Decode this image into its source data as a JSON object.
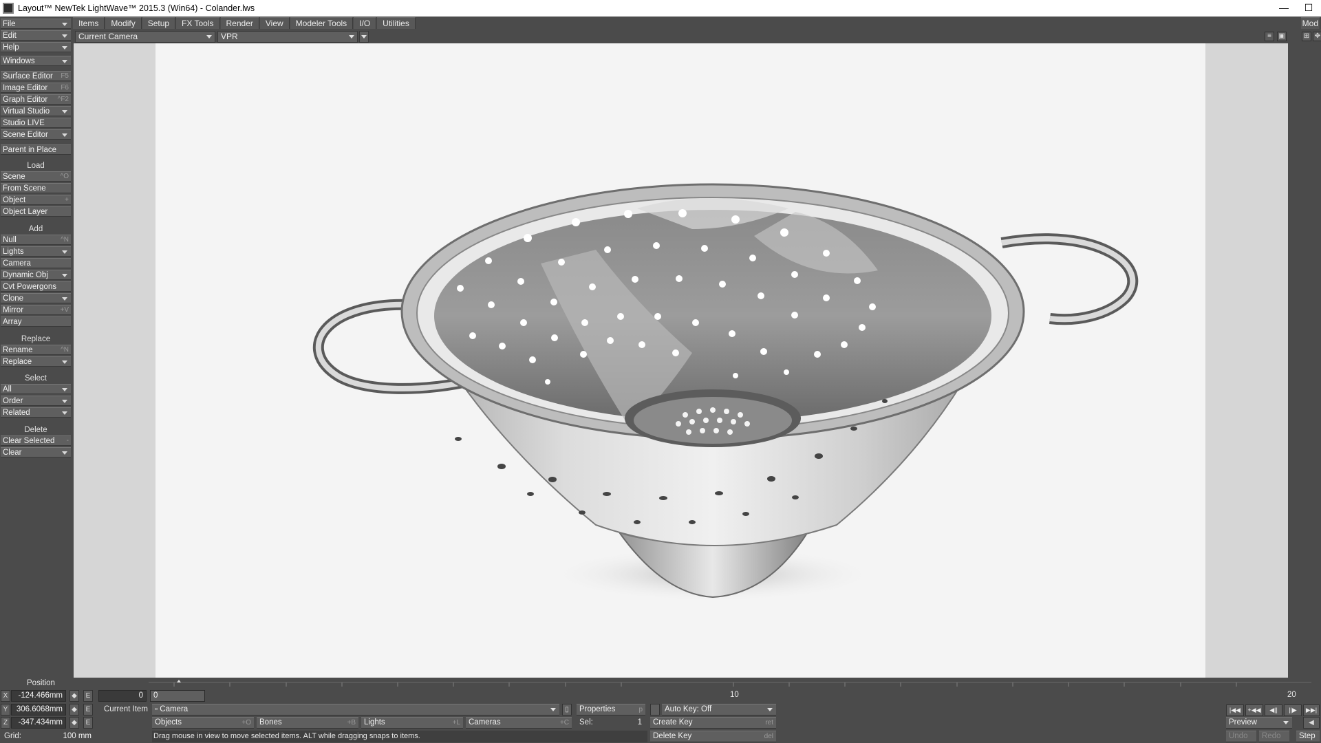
{
  "window": {
    "title": "Layout™ NewTek LightWave™ 2015.3 (Win64) - Colander.lws",
    "minimize": "—",
    "maximize": "☐"
  },
  "menu": {
    "file": "File",
    "edit": "Edit",
    "help": "Help",
    "windows": "Windows",
    "editors": [
      {
        "label": "Surface Editor",
        "shortcut": "F5"
      },
      {
        "label": "Image Editor",
        "shortcut": "F6"
      },
      {
        "label": "Graph Editor",
        "shortcut": "^F2"
      },
      {
        "label": "Virtual Studio",
        "shortcut": ""
      },
      {
        "label": "Studio LIVE",
        "shortcut": ""
      },
      {
        "label": "Scene Editor",
        "shortcut": ""
      }
    ],
    "parent_in_place": "Parent in Place",
    "load_header": "Load",
    "load": [
      {
        "label": "Scene",
        "shortcut": "^O"
      },
      {
        "label": "From Scene",
        "shortcut": ""
      },
      {
        "label": "Object",
        "shortcut": "+"
      },
      {
        "label": "Object Layer",
        "shortcut": ""
      }
    ],
    "add_header": "Add",
    "add": [
      {
        "label": "Null",
        "shortcut": "^N"
      },
      {
        "label": "Lights",
        "shortcut": ""
      },
      {
        "label": "Camera",
        "shortcut": ""
      },
      {
        "label": "Dynamic Obj",
        "shortcut": ""
      },
      {
        "label": "Cvt Powergons",
        "shortcut": ""
      },
      {
        "label": "Clone",
        "shortcut": ""
      },
      {
        "label": "Mirror",
        "shortcut": "+V"
      },
      {
        "label": "Array",
        "shortcut": ""
      }
    ],
    "replace_header": "Replace",
    "replace": [
      {
        "label": "Rename",
        "shortcut": "^N"
      },
      {
        "label": "Replace",
        "shortcut": ""
      }
    ],
    "select_header": "Select",
    "select": [
      {
        "label": "All",
        "shortcut": ""
      },
      {
        "label": "Order",
        "shortcut": ""
      },
      {
        "label": "Related",
        "shortcut": ""
      }
    ],
    "delete_header": "Delete",
    "delete": [
      {
        "label": "Clear Selected",
        "shortcut": "-"
      },
      {
        "label": "Clear",
        "shortcut": ""
      }
    ]
  },
  "tabs": [
    "Items",
    "Modify",
    "Setup",
    "FX Tools",
    "Render",
    "View",
    "Modeler Tools",
    "I/O",
    "Utilities"
  ],
  "modeler_button": "Mod",
  "viewport": {
    "view_type": "Current Camera",
    "render_mode": "VPR"
  },
  "position": {
    "header": "Position",
    "x": {
      "axis": "X",
      "value": "-124.466mm"
    },
    "y": {
      "axis": "Y",
      "value": "306.6068mm"
    },
    "z": {
      "axis": "Z",
      "value": "-347.434mm"
    },
    "env_label": "E",
    "grid_label": "Grid:",
    "grid_value": "100 mm"
  },
  "timeline": {
    "start_frame": "0",
    "current_frame": "0",
    "ticks": [
      "0",
      "10",
      "20"
    ]
  },
  "current_item": {
    "label": "Current Item",
    "value": "Camera"
  },
  "properties": "Properties",
  "properties_shortcut": "p",
  "auto_key": "Auto Key: Off",
  "item_types": [
    {
      "label": "Objects",
      "shortcut": "+O"
    },
    {
      "label": "Bones",
      "shortcut": "+B"
    },
    {
      "label": "Lights",
      "shortcut": "+L"
    },
    {
      "label": "Cameras",
      "shortcut": "+C"
    }
  ],
  "sel": {
    "label": "Sel:",
    "value": "1"
  },
  "create_key": {
    "label": "Create Key",
    "shortcut": "ret"
  },
  "delete_key": {
    "label": "Delete Key",
    "shortcut": "del"
  },
  "preview": "Preview",
  "undo": "Undo",
  "redo": "Redo",
  "step": "Step",
  "status_text": "Drag mouse in view to move selected items. ALT while dragging snaps to items."
}
